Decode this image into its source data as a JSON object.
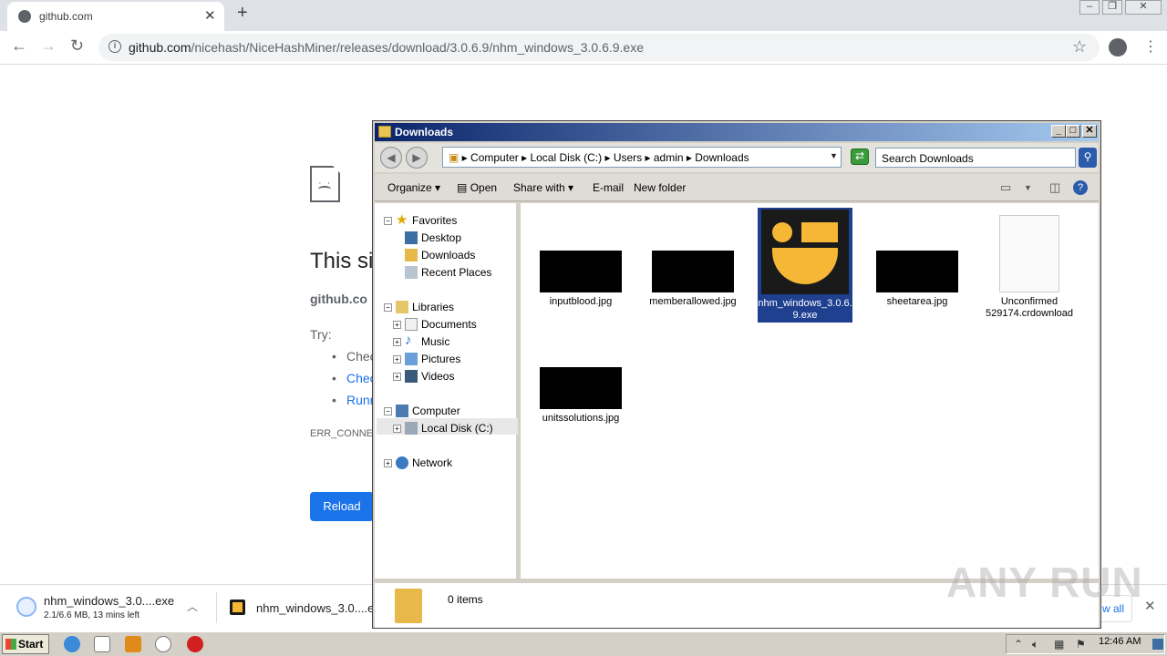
{
  "browser": {
    "tab_title": "github.com",
    "url_host": "github.com",
    "url_path": "/nicehash/NiceHashMiner/releases/download/3.0.6.9/nhm_windows_3.0.6.9.exe"
  },
  "error_page": {
    "title": "This si",
    "host": "github.co",
    "try_label": "Try:",
    "items": [
      "Chec",
      "Chec",
      "Runn"
    ],
    "code": "ERR_CONNEC",
    "reload_label": "Reload"
  },
  "downloads": {
    "item1_name": "nhm_windows_3.0....exe",
    "item1_status": "2.1/6.6 MB, 13 mins left",
    "item2_name": "nhm_windows_3.0....e",
    "show_all": "w all"
  },
  "taskbar": {
    "start_label": "Start",
    "clock": "12:46 AM"
  },
  "explorer": {
    "title": "Downloads",
    "breadcrumbs": [
      "Computer",
      "Local Disk (C:)",
      "Users",
      "admin",
      "Downloads"
    ],
    "search_placeholder": "Search Downloads",
    "commands": {
      "organize": "Organize",
      "open": "Open",
      "share_with": "Share with",
      "email": "E-mail",
      "new_folder": "New folder"
    },
    "tree": {
      "favorites": "Favorites",
      "desktop": "Desktop",
      "downloads": "Downloads",
      "recent": "Recent Places",
      "libraries": "Libraries",
      "documents": "Documents",
      "music": "Music",
      "pictures": "Pictures",
      "videos": "Videos",
      "computer": "Computer",
      "local_disk": "Local Disk (C:)",
      "network": "Network"
    },
    "files": {
      "f1": "inputblood.jpg",
      "f2": "memberallowed.jpg",
      "f3": "nhm_windows_3.0.6.9.exe",
      "f4": "sheetarea.jpg",
      "f5": "Unconfirmed 529174.crdownload",
      "f6": "unitssolutions.jpg"
    },
    "status_count": "0 items"
  },
  "watermark": "ANY RUN",
  "colors": {
    "chrome_blue": "#1a73e8",
    "titlebar": "#0a246a",
    "selection": "#1f3f8f",
    "nicehash_yellow": "#f5b735"
  }
}
